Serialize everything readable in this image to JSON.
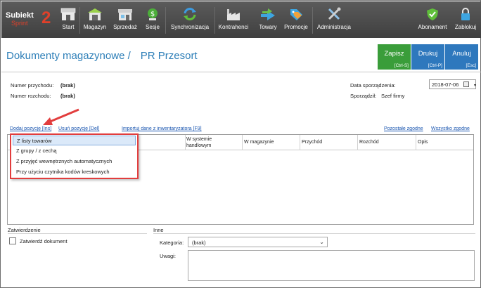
{
  "app": {
    "logo_brand": "Subiekt",
    "logo_product": "Sprint",
    "logo_version": "2"
  },
  "toolbar": {
    "items": [
      {
        "label": "Start",
        "icon": "store-icon"
      },
      {
        "label": "Magazyn",
        "icon": "warehouse-icon"
      },
      {
        "label": "Sprzedaż",
        "icon": "shop-icon"
      },
      {
        "label": "Sesje",
        "icon": "cash-session-icon"
      },
      {
        "label": "Synchronizacja",
        "icon": "sync-icon"
      },
      {
        "label": "Kontrahenci",
        "icon": "factory-icon"
      },
      {
        "label": "Towary",
        "icon": "goods-icon"
      },
      {
        "label": "Promocje",
        "icon": "tags-icon"
      },
      {
        "label": "Administracja",
        "icon": "tools-icon"
      },
      {
        "label": "Abonament",
        "icon": "shield-icon"
      },
      {
        "label": "Zablokuj",
        "icon": "lock-icon"
      }
    ]
  },
  "header": {
    "title": "Dokumenty magazynowe /",
    "subtitle": "PR Przesort",
    "buttons": [
      {
        "label": "Zapisz",
        "shortcut": "[Ctrl-S]",
        "color": "#3a9d3a"
      },
      {
        "label": "Drukuj",
        "shortcut": "[Ctrl-P]",
        "color": "#2e78bd"
      },
      {
        "label": "Anuluj",
        "shortcut": "[Esc]",
        "color": "#2e78bd"
      }
    ]
  },
  "fields": {
    "numer_przychodu_label": "Numer przychodu:",
    "numer_przychodu_value": "(brak)",
    "numer_rozchodu_label": "Numer rozchodu:",
    "numer_rozchodu_value": "(brak)",
    "data_label": "Data sporządzenia:",
    "data_value": "2018-07-06",
    "sporzadzil_label": "Sporządził:",
    "sporzadzil_value": "Szef firmy"
  },
  "links": {
    "dodaj": "Dodaj pozycję [Ins]",
    "usun": "Usuń pozycję [Del]",
    "importuj": "Importuj dane z inwentaryzatora [F9]",
    "pozostale": "Pozostałe zgodne",
    "wszystko": "Wszystko zgodne"
  },
  "grid": {
    "columns": [
      "W systemie",
      "handlowym",
      "W magazynie",
      "Przychód",
      "Rozchód",
      "Opis"
    ]
  },
  "dropdown": {
    "items": [
      "Z listy towarów",
      "Z grupy / z cechą",
      "Z przyjęć wewnętrznych automatycznych",
      "Przy użyciu czytnika kodów kreskowych"
    ],
    "selected_index": 0
  },
  "bottom": {
    "zatwierdzenie_title": "Zatwierdzenie",
    "zatwierdz_label": "Zatwierdź dokument",
    "zatwierdz_checked": false,
    "inne_title": "Inne",
    "kategoria_label": "Kategoria:",
    "kategoria_value": "(brak)",
    "uwagi_label": "Uwagi:",
    "uwagi_value": ""
  },
  "colors": {
    "toolbar_bg": "#4a4a4a",
    "title": "#2e7fb8",
    "link": "#1a56b0",
    "highlight": "#e23d3d"
  }
}
